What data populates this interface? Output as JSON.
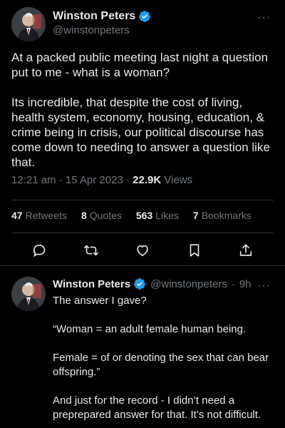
{
  "main_tweet": {
    "display_name": "Winston Peters",
    "handle": "@winstonpeters",
    "more_label": "···",
    "text": "At a packed public meeting last night a question put to me - what is a woman?\n\nIts incredible, that despite the cost of living, health system, economy, housing, education, & crime being in crisis, our political discourse has come down to needing to answer a question like that.",
    "time": "12:21 am",
    "date": "15 Apr 2023",
    "views_count": "22.9K",
    "views_label": "Views",
    "stats": [
      {
        "count": "47",
        "label": "Retweets"
      },
      {
        "count": "8",
        "label": "Quotes"
      },
      {
        "count": "563",
        "label": "Likes"
      },
      {
        "count": "7",
        "label": "Bookmarks"
      }
    ],
    "actions": [
      "reply-icon",
      "retweet-icon",
      "like-icon",
      "bookmark-icon",
      "share-icon"
    ]
  },
  "reply_tweet": {
    "display_name": "Winston Peters",
    "handle": "@winstonpeters",
    "age": "9h",
    "more_label": "···",
    "text": "The answer I gave?\n\n“Woman = an adult female human being.\n\nFemale = of or denoting the sex that can bear offspring.”\n\nAnd just for the record - I didn’t need a preprepared answer for that. It’s not difficult."
  },
  "colors": {
    "background": "#000000",
    "text_primary": "#e7e9ea",
    "text_secondary": "#71767b",
    "verified_blue": "#1d9bf0",
    "divider": "#2f3336"
  }
}
